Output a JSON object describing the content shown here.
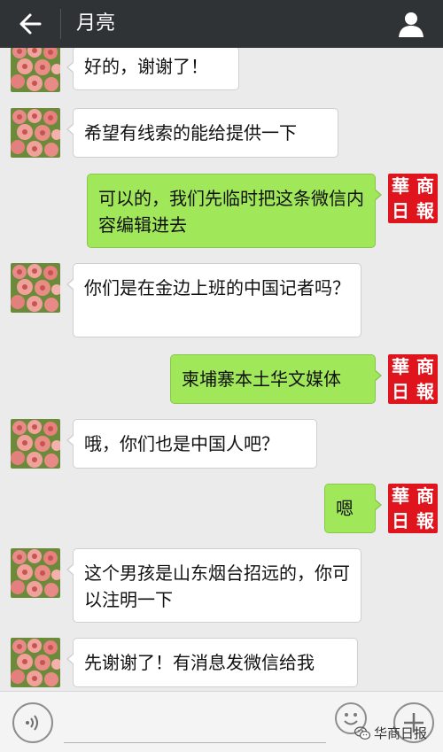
{
  "header": {
    "title": "月亮"
  },
  "avatar_logo": {
    "c1": "華",
    "c2": "商",
    "c3": "日",
    "c4": "報"
  },
  "messages": [
    {
      "side": "in",
      "text": "好的，谢谢了！"
    },
    {
      "side": "in",
      "text": "希望有线索的能给提供一下"
    },
    {
      "side": "out",
      "text": "可以的，我们先临时把这条微信内容编辑进去"
    },
    {
      "side": "in",
      "text": "你们是在金边上班的中国记者吗？"
    },
    {
      "side": "out",
      "text": "柬埔寨本土华文媒体"
    },
    {
      "side": "in",
      "text": "哦，你们也是中国人吧？"
    },
    {
      "side": "out",
      "text": "嗯"
    },
    {
      "side": "in",
      "text": "这个男孩是山东烟台招远的，你可以注明一下"
    },
    {
      "side": "in",
      "text": "先谢谢了！有消息发微信给我"
    }
  ],
  "inputbar": {
    "placeholder": "",
    "watermark": "华商日报"
  },
  "icons": {
    "back": "back-arrow-icon",
    "profile": "person-icon",
    "voice": "voice-icon",
    "emoji": "emoji-icon",
    "plus": "plus-icon"
  },
  "colors": {
    "header_bg": "#2f3335",
    "chat_bg": "#ebebeb",
    "incoming_bubble": "#ffffff",
    "outgoing_bubble": "#a0e75a",
    "logo_red": "#e0141c"
  }
}
